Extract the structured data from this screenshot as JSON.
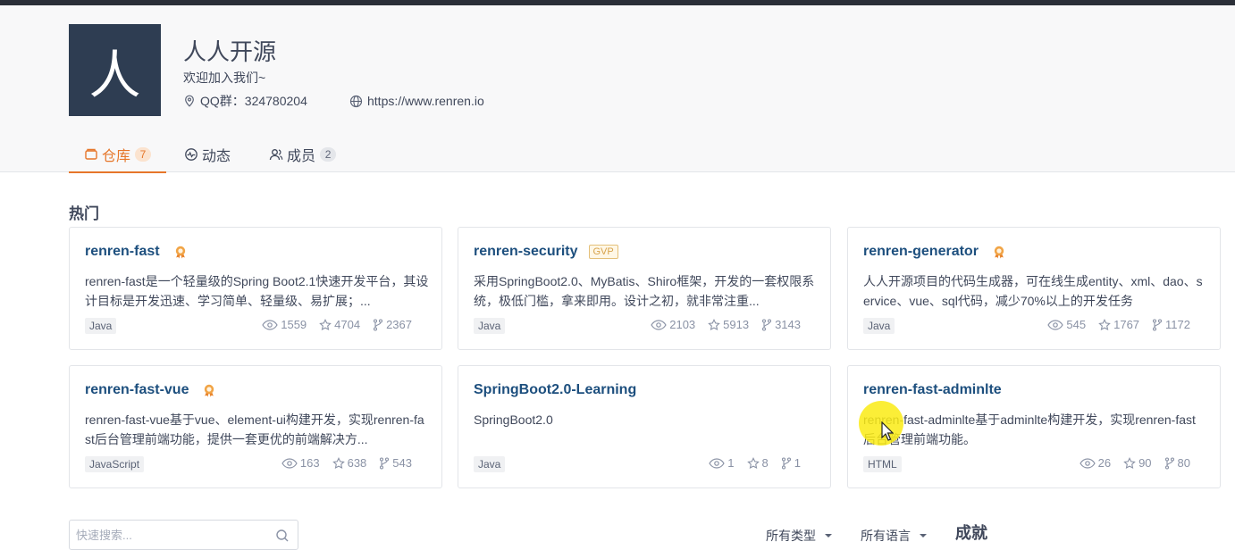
{
  "org": {
    "avatar_char": "人",
    "name": "人人开源",
    "description": "欢迎加入我们~",
    "qq_label": "QQ群：324780204",
    "website": "https://www.renren.io"
  },
  "tabs": [
    {
      "label": "仓库",
      "count": "7",
      "active": true
    },
    {
      "label": "动态",
      "count": "",
      "active": false
    },
    {
      "label": "成员",
      "count": "2",
      "active": false
    }
  ],
  "section_title": "热门",
  "repos": [
    {
      "name": "renren-fast",
      "badge": "medal",
      "desc": "renren-fast是一个轻量级的Spring Boot2.1快速开发平台，其设计目标是开发迅速、学习简单、轻量级、易扩展；...",
      "lang": "Java",
      "watch": "1559",
      "star": "4704",
      "fork": "2367"
    },
    {
      "name": "renren-security",
      "badge": "GVP",
      "desc": "采用SpringBoot2.0、MyBatis、Shiro框架，开发的一套权限系统，极低门槛，拿来即用。设计之初，就非常注重...",
      "lang": "Java",
      "watch": "2103",
      "star": "5913",
      "fork": "3143"
    },
    {
      "name": "renren-generator",
      "badge": "medal",
      "desc": "人人开源项目的代码生成器，可在线生成entity、xml、dao、service、vue、sql代码，减少70%以上的开发任务",
      "lang": "Java",
      "watch": "545",
      "star": "1767",
      "fork": "1172"
    },
    {
      "name": "renren-fast-vue",
      "badge": "medal",
      "desc": "renren-fast-vue基于vue、element-ui构建开发，实现renren-fast后台管理前端功能，提供一套更优的前端解决方...",
      "lang": "JavaScript",
      "watch": "163",
      "star": "638",
      "fork": "543"
    },
    {
      "name": "SpringBoot2.0-Learning",
      "badge": "",
      "desc": "SpringBoot2.0",
      "lang": "Java",
      "watch": "1",
      "star": "8",
      "fork": "1"
    },
    {
      "name": "renren-fast-adminlte",
      "badge": "",
      "desc": "renren-fast-adminlte基于adminlte构建开发，实现renren-fast后台管理前端功能。",
      "lang": "HTML",
      "watch": "26",
      "star": "90",
      "fork": "80"
    }
  ],
  "search": {
    "placeholder": "快速搜索..."
  },
  "filters": {
    "type": "所有类型",
    "language": "所有语言"
  },
  "achievement": "成就",
  "colors": {
    "accent": "#e6762a",
    "repo_title": "#1d4f7e",
    "avatar_bg": "#2e3d52"
  }
}
